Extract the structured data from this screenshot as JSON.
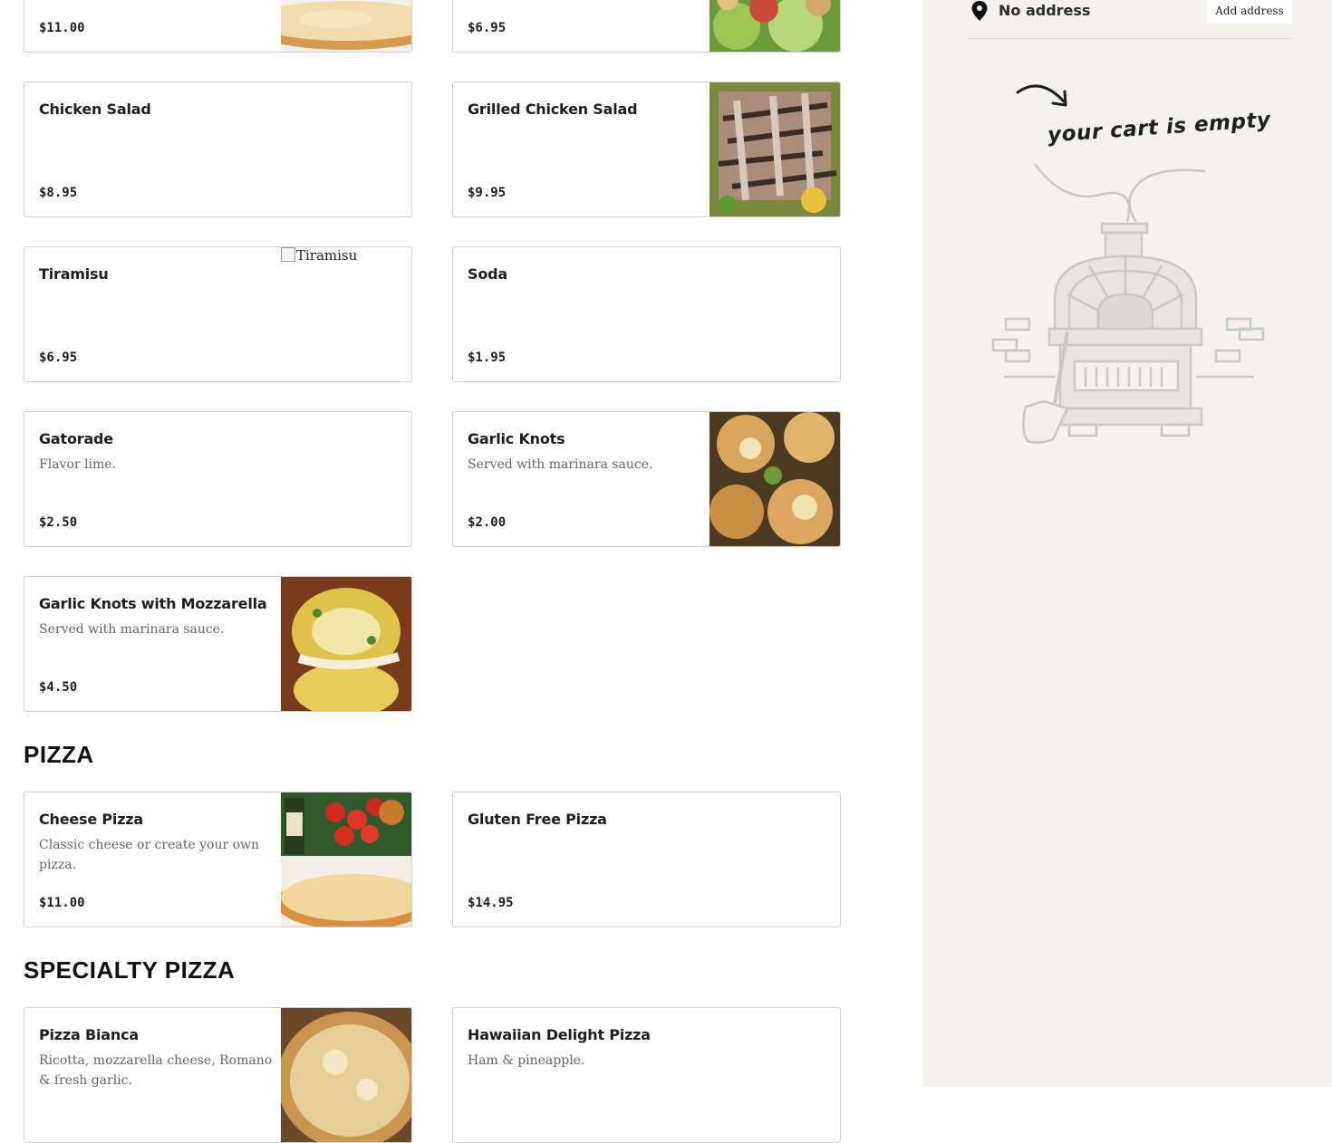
{
  "menu": {
    "top_items": [
      {
        "price": "$11.00"
      },
      {
        "price": "$6.95"
      }
    ],
    "items": [
      {
        "name": "Chicken Salad",
        "description": "",
        "price": "$8.95"
      },
      {
        "name": "Grilled Chicken Salad",
        "description": "",
        "price": "$9.95"
      },
      {
        "name": "Tiramisu",
        "description": "",
        "price": "$6.95",
        "image_alt": "Tiramisu"
      },
      {
        "name": "Soda",
        "description": "",
        "price": "$1.95"
      },
      {
        "name": "Gatorade",
        "description": "Flavor lime.",
        "price": "$2.50"
      },
      {
        "name": "Garlic Knots",
        "description": "Served with marinara sauce.",
        "price": "$2.00"
      },
      {
        "name": "Garlic Knots with Mozzarella",
        "description": "Served with marinara sauce.",
        "price": "$4.50"
      }
    ],
    "sections": [
      {
        "title": "PIZZA",
        "items": [
          {
            "name": "Cheese Pizza",
            "description": "Classic cheese or create your own pizza.",
            "price": "$11.00"
          },
          {
            "name": "Gluten Free Pizza",
            "description": "",
            "price": "$14.95"
          }
        ]
      },
      {
        "title": "SPECIALTY PIZZA",
        "items": [
          {
            "name": "Pizza Bianca",
            "description": "Ricotta, mozzarella cheese, Romano & fresh garlic."
          },
          {
            "name": "Hawaiian Delight Pizza",
            "description": "Ham & pineapple."
          }
        ]
      }
    ]
  },
  "cart": {
    "address": "No address",
    "add_address_label": "Add address",
    "empty_message": "your cart is empty"
  },
  "icons": {
    "pin": "location-pin-icon",
    "arrow": "curved-arrow-icon",
    "oven": "pizza-oven-illustration"
  },
  "colors": {
    "sidebar_bg": "#f3f2ef",
    "card_border": "#cfcfcf",
    "description_text": "#666666"
  }
}
